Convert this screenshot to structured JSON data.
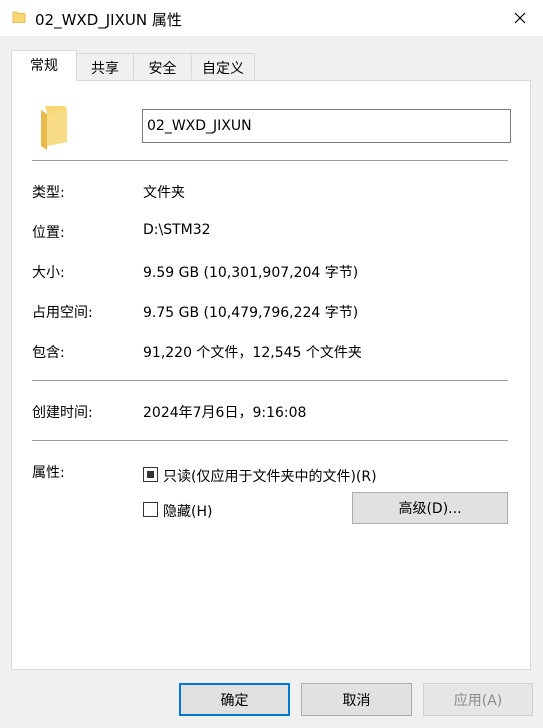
{
  "window": {
    "title": "02_WXD_JIXUN 属性"
  },
  "tabs": [
    {
      "label": "常规"
    },
    {
      "label": "共享"
    },
    {
      "label": "安全"
    },
    {
      "label": "自定义"
    }
  ],
  "general": {
    "name_value": "02_WXD_JIXUN",
    "rows": {
      "type": {
        "label": "类型:",
        "value": "文件夹"
      },
      "location": {
        "label": "位置:",
        "value": "D:\\STM32"
      },
      "size": {
        "label": "大小:",
        "value": "9.59 GB (10,301,907,204 字节)"
      },
      "size_on_disk": {
        "label": "占用空间:",
        "value": "9.75 GB (10,479,796,224 字节)"
      },
      "contains": {
        "label": "包含:",
        "value": "91,220 个文件，12,545 个文件夹"
      },
      "created": {
        "label": "创建时间:",
        "value": "2024年7月6日，9:16:08"
      }
    },
    "attributes": {
      "label": "属性:",
      "readonly_label": "只读(仅应用于文件夹中的文件)(R)",
      "hidden_label": "隐藏(H)",
      "advanced_label": "高级(D)..."
    }
  },
  "buttons": {
    "ok": "确定",
    "cancel": "取消",
    "apply": "应用(A)"
  },
  "colors": {
    "folder": "#f8d775",
    "folder_dark": "#e8b84a",
    "accent": "#0078d7"
  }
}
